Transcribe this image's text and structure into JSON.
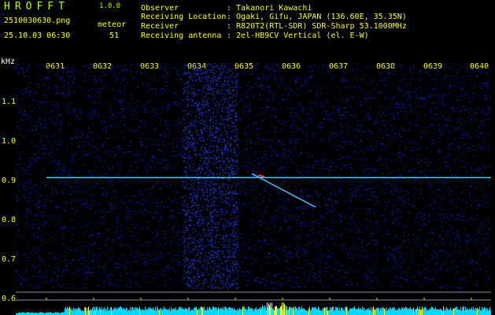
{
  "header": {
    "logo": "HROFFT",
    "version": "1.0.0",
    "filename": "2510030630.png",
    "meteor_label": "meteor",
    "datetime": "25.10.03 06:30",
    "meteor_count": "51"
  },
  "info": [
    {
      "key": "Observer",
      "value": ": Takanori Kawachi"
    },
    {
      "key": "Receiving Location",
      "value": ": Ogaki, Gifu, JAPAN (136.60E, 35.35N)"
    },
    {
      "key": "Receiver",
      "value": ": R820T2(RTL-SDR) SDR-Sharp 53.1000MHz"
    },
    {
      "key": "Receiving antenna",
      "value": ": 2el-HB9CV Vertical (el. E-W)"
    }
  ],
  "spectrogram": {
    "y_unit": "kHz",
    "x_ticks": [
      "0631",
      "0632",
      "0633",
      "0634",
      "0635",
      "0636",
      "0637",
      "0638",
      "0639",
      "0640"
    ],
    "y_ticks": [
      "1.1",
      "1.0",
      "0.9",
      "0.8",
      "0.7",
      "0.6"
    ],
    "x_range": [
      "0630",
      "0640"
    ],
    "y_range_khz": [
      0.58,
      1.2
    ],
    "carrier_khz": 0.905,
    "carrier_start_min": 1.0,
    "meteor_trail": {
      "start_min": 5.35,
      "start_khz": 0.915,
      "end_min": 6.7,
      "end_khz": 0.83
    },
    "colors": {
      "background": "#000000",
      "noise": "#0a22c8",
      "carrier": "#50c8ff",
      "meteor": "#ff4040",
      "bottom_bar": "#00d8ff",
      "bottom_peak": "#ffff00"
    }
  }
}
